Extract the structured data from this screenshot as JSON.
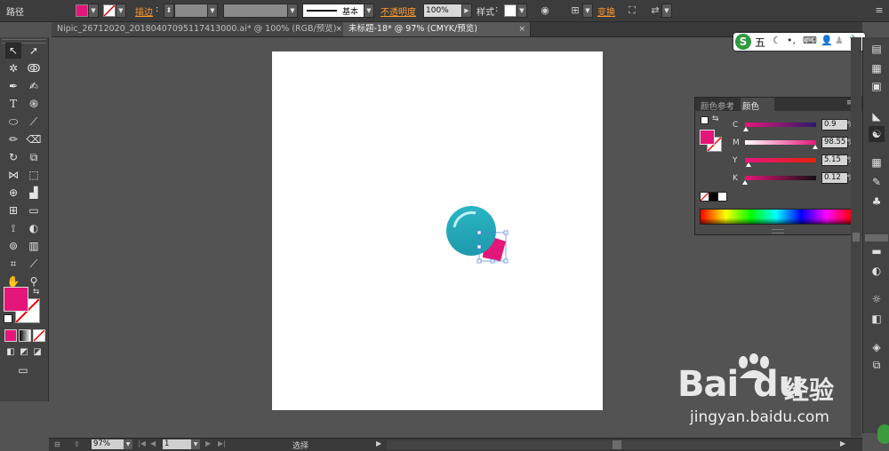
{
  "control_bar": {
    "path_label": "路径",
    "stroke_label": "描边",
    "stroke_profile": "基本",
    "opacity_label": "不透明度",
    "opacity_value": "100%",
    "style_label": "样式",
    "transform_label": "变换",
    "fill_color": "#e5167a"
  },
  "tabs": [
    {
      "label": "Nipic_26712020_20180407095117413000.ai* @ 100% (RGB/预览)",
      "close": "×"
    },
    {
      "label": "未标题-18* @ 97% (CMYK/预览)",
      "close": "×"
    }
  ],
  "color_panel": {
    "tab_guide": "颜色参考",
    "tab_color": "颜色",
    "channels": [
      {
        "label": "C",
        "value": "0.9",
        "unit": "%",
        "fraction": 0.009
      },
      {
        "label": "M",
        "value": "98.55",
        "unit": "%",
        "fraction": 0.9855
      },
      {
        "label": "Y",
        "value": "5.15",
        "unit": "%",
        "fraction": 0.0515
      },
      {
        "label": "K",
        "value": "0.12",
        "unit": "%",
        "fraction": 0.0012
      }
    ],
    "fill_color": "#e5167a"
  },
  "status_bar": {
    "zoom": "97%",
    "page": "1",
    "tool": "选择"
  },
  "ime": {
    "label": "五"
  },
  "watermark": {
    "brand": "Bai",
    "brand_tail": "du",
    "cn": "经验",
    "url": "jingyan.baidu.com"
  },
  "toolbar": {
    "fill_color": "#e5167a"
  }
}
